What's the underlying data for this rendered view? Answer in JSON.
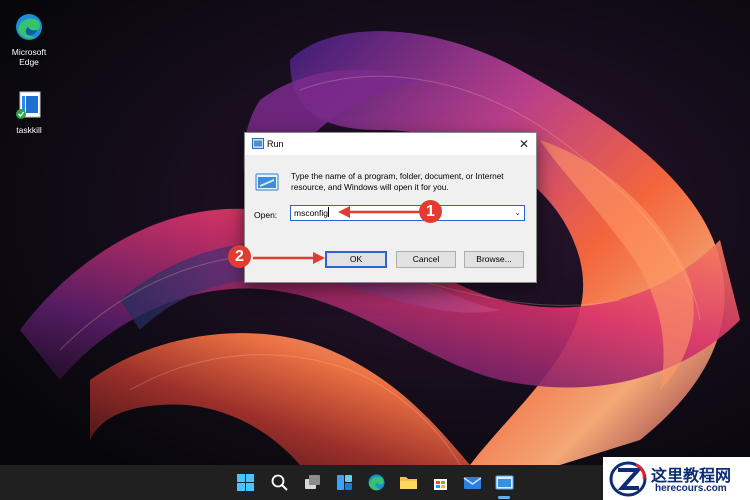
{
  "desktop": {
    "icons": [
      {
        "label_line1": "Microsoft",
        "label_line2": "Edge",
        "icon": "edge-icon"
      },
      {
        "label_line1": "taskkill",
        "label_line2": "",
        "icon": "shortcut-file-icon"
      }
    ]
  },
  "run_dialog": {
    "title": "Run",
    "description": "Type the name of a program, folder, document, or Internet resource, and Windows will open it for you.",
    "open_label": "Open:",
    "open_value": "msconfig",
    "ok_label": "OK",
    "cancel_label": "Cancel",
    "browse_label": "Browse..."
  },
  "callouts": {
    "one": "1",
    "two": "2",
    "color": "#e23b32"
  },
  "taskbar": {
    "icons": [
      "windows-start-icon",
      "search-icon",
      "task-view-icon",
      "widgets-icon",
      "edge-icon",
      "file-explorer-icon",
      "store-icon",
      "mail-icon",
      "run-icon"
    ]
  },
  "watermark": {
    "text": "这里教程网",
    "url": "herecours.com"
  }
}
